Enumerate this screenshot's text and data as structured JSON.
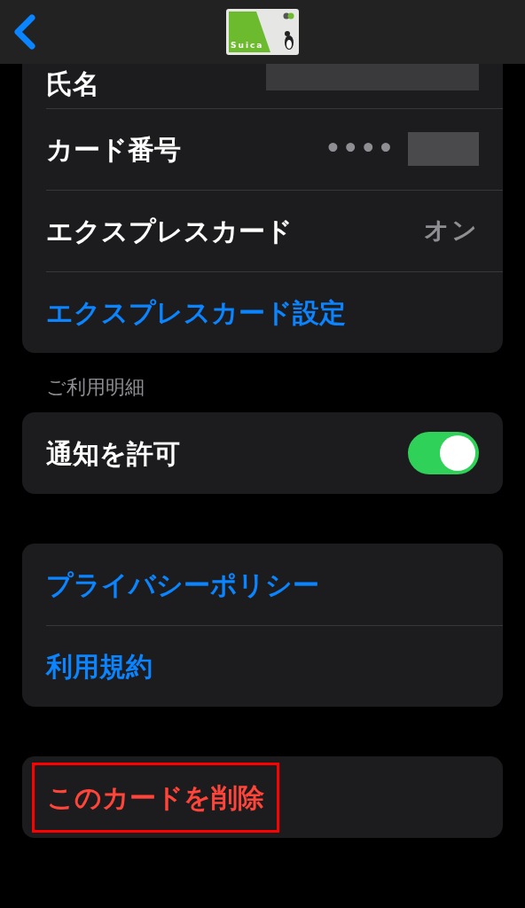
{
  "nav_bar": {
    "card_logo_text": "Suica"
  },
  "card_info": {
    "rows": [
      {
        "kind": "value",
        "label": "氏名",
        "redacted": true
      },
      {
        "kind": "value",
        "label": "カード番号",
        "value": "••••",
        "redacted": true
      },
      {
        "kind": "value",
        "label": "エクスプレスカード",
        "value": "オン"
      },
      {
        "kind": "link",
        "label": "エクスプレスカード設定"
      }
    ]
  },
  "statement": {
    "header": "ご利用明細",
    "rows": [
      {
        "kind": "toggle",
        "label": "通知を許可",
        "on": true
      }
    ]
  },
  "legal": {
    "rows": [
      {
        "kind": "link",
        "label": "プライバシーポリシー"
      },
      {
        "kind": "link",
        "label": "利用規約"
      }
    ]
  },
  "delete": {
    "rows": [
      {
        "kind": "destructive",
        "label": "このカードを削除",
        "highlighted": true
      }
    ]
  }
}
